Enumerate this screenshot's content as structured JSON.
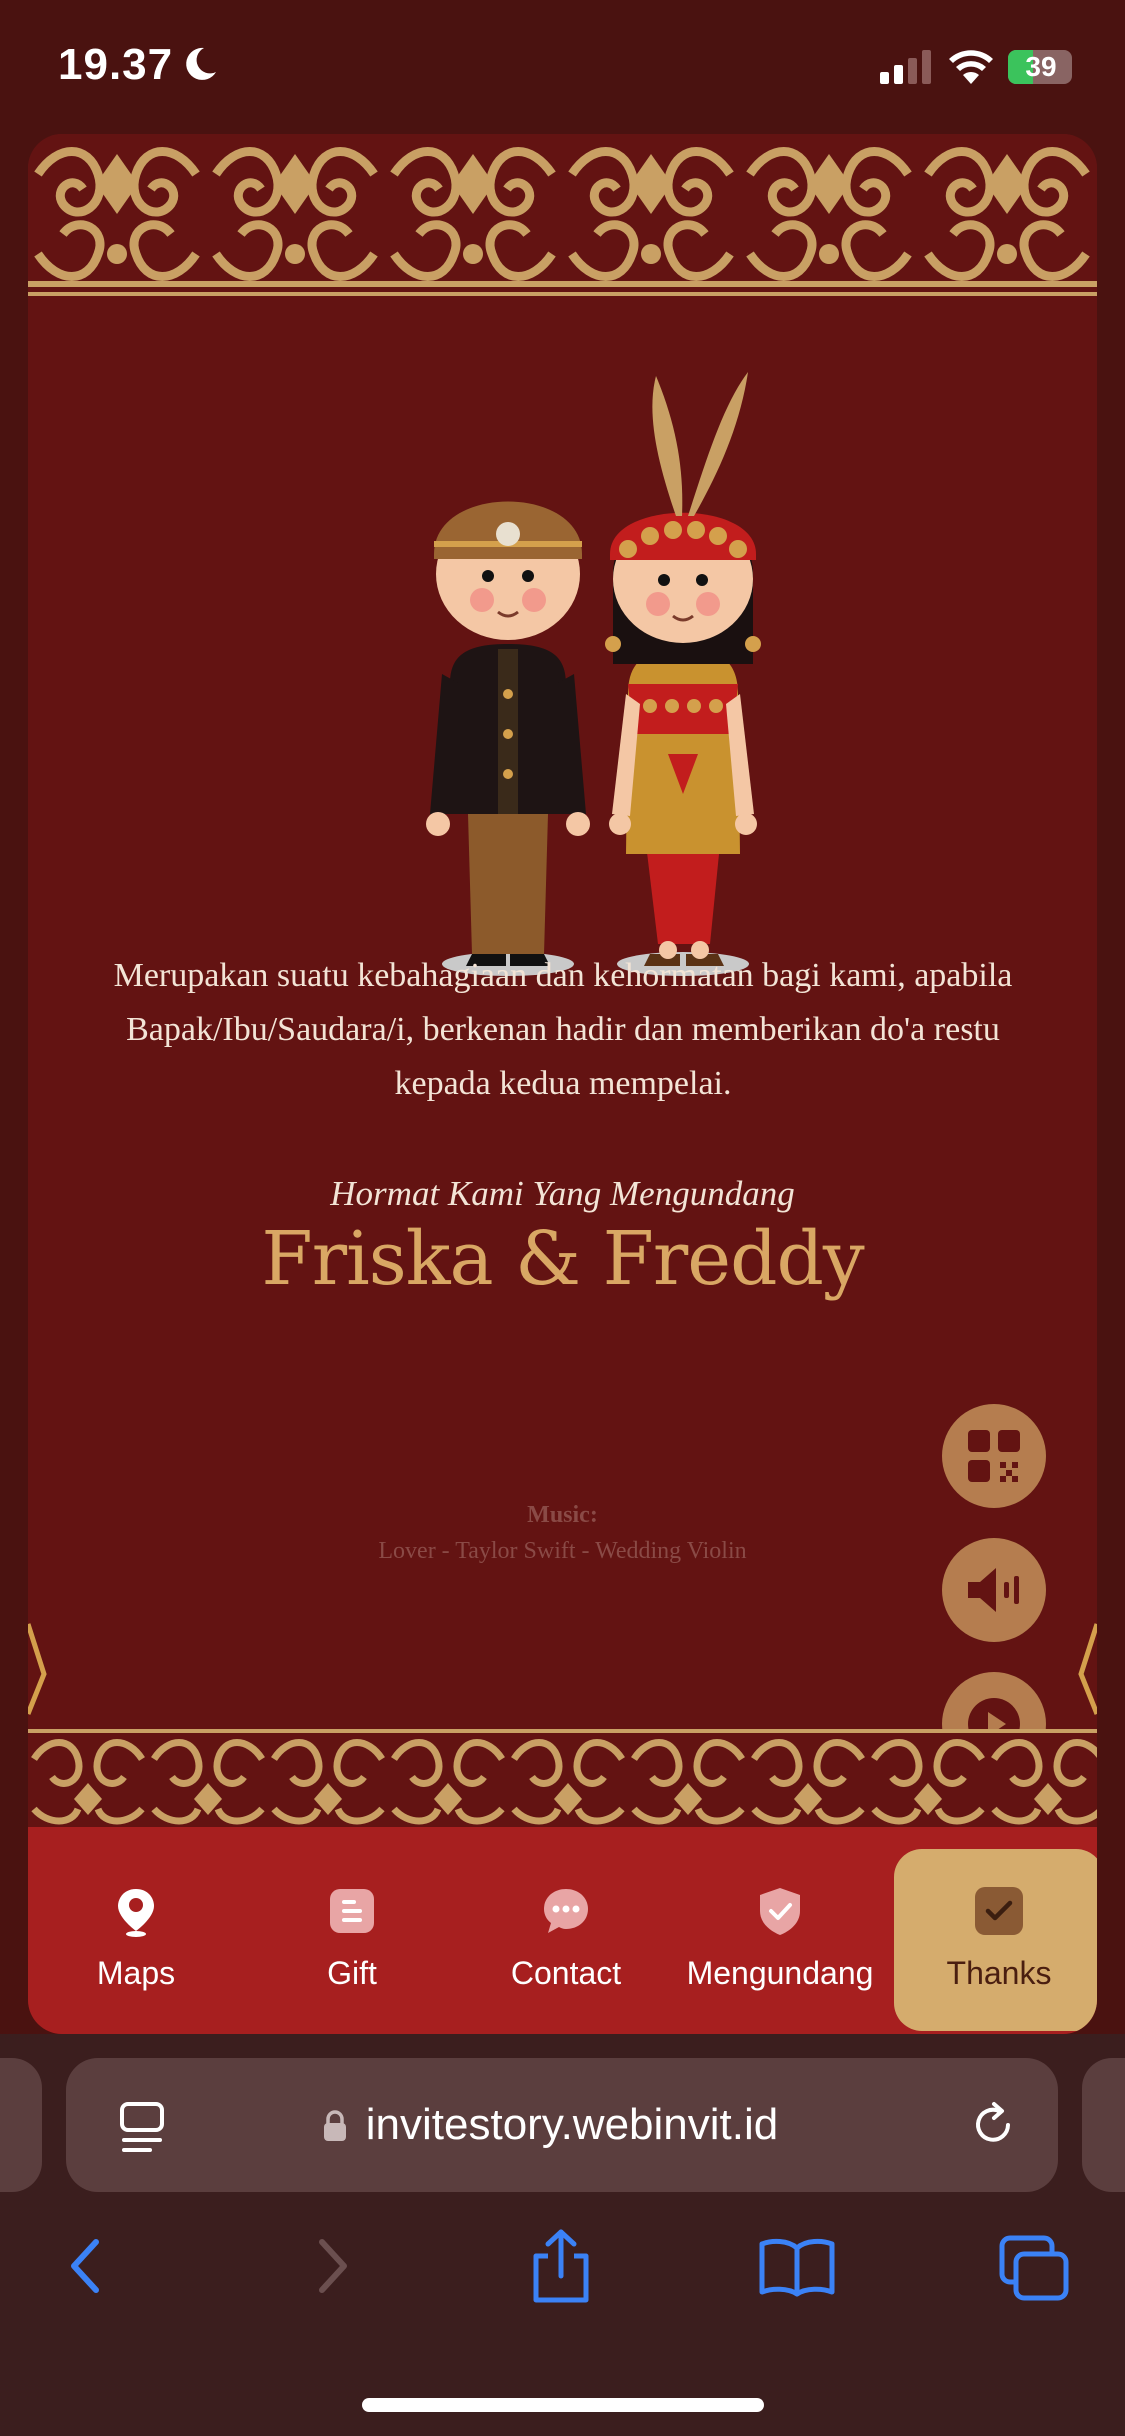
{
  "status_bar": {
    "time": "19.37",
    "battery_level": "39"
  },
  "invitation": {
    "message": "Merupakan suatu kebahagiaan dan kehormatan bagi kami, apabila Bapak/Ibu/Saudara/i, berkenan hadir dan memberikan do'a restu kepada kedua mempelai.",
    "closing": "Hormat Kami Yang Mengundang",
    "names": "Friska & Freddy",
    "music_label": "Music:",
    "music_title": "Lover - Taylor Swift - Wedding Violin"
  },
  "floating_buttons": [
    {
      "icon": "qr-code-icon"
    },
    {
      "icon": "speaker-icon"
    },
    {
      "icon": "play-icon"
    }
  ],
  "bottom_nav": {
    "items": [
      {
        "label": "Maps",
        "icon": "map-pin-icon",
        "active": false
      },
      {
        "label": "Gift",
        "icon": "gift-icon",
        "active": false
      },
      {
        "label": "Contact",
        "icon": "chat-icon",
        "active": false
      },
      {
        "label": "Mengundang",
        "icon": "shield-check-icon",
        "active": false
      },
      {
        "label": "Thanks",
        "icon": "check-box-icon",
        "active": true
      }
    ]
  },
  "browser": {
    "url": "invitestory.webinvit.id"
  },
  "colors": {
    "background": "#4a1210",
    "card": "#631312",
    "gold": "#d9a764",
    "nav": "#a71f1f",
    "nav_active": "#d5ac6d",
    "browser_chrome": "#3b1e1e"
  }
}
